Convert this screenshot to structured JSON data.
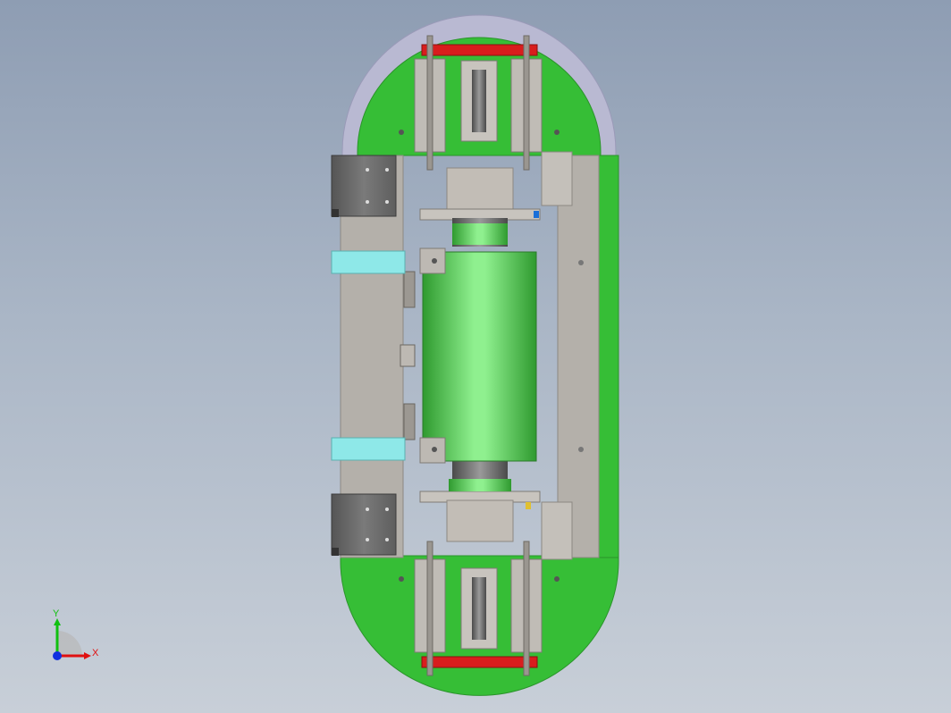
{
  "viewport": {
    "background_top": "#8e9db3",
    "background_bottom": "#c8cfd8"
  },
  "model": {
    "colors": {
      "base_plate": "#36be36",
      "rail_ring": "#b9b9d2",
      "frame_gray": "#b4b0aa",
      "roller_green": "#6fde6f",
      "bumper_red": "#d81d1d",
      "sensor_cyan": "#8ee8e8",
      "motor_dark": "#6f6f6f"
    }
  },
  "triad": {
    "x_label": "X",
    "y_label": "Y",
    "x_color": "#e01010",
    "y_color": "#10c010",
    "z_color": "#1030e0"
  }
}
